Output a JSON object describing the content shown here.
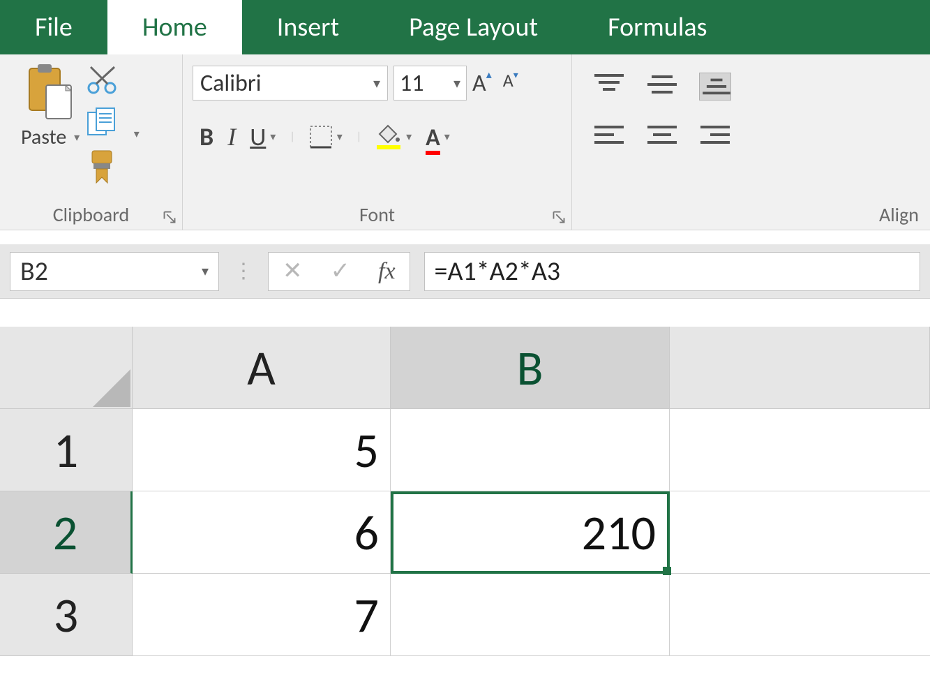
{
  "tabs": {
    "file": "File",
    "home": "Home",
    "insert": "Insert",
    "pagelayout": "Page Layout",
    "formulas": "Formulas"
  },
  "ribbon": {
    "clipboard": {
      "label": "Clipboard",
      "paste": "Paste"
    },
    "font": {
      "label": "Font",
      "name": "Calibri",
      "size": "11",
      "bold": "B",
      "italic": "I",
      "underline": "U"
    },
    "alignment": {
      "label": "Align"
    }
  },
  "formula_bar": {
    "name_box": "B2",
    "fx": "fx",
    "formula": "=A1*A2*A3"
  },
  "grid": {
    "columns": [
      "A",
      "B"
    ],
    "rows": [
      "1",
      "2",
      "3"
    ],
    "cells": {
      "A1": "5",
      "A2": "6",
      "A3": "7",
      "B1": "",
      "B2": "210",
      "B3": ""
    },
    "selected": "B2"
  }
}
